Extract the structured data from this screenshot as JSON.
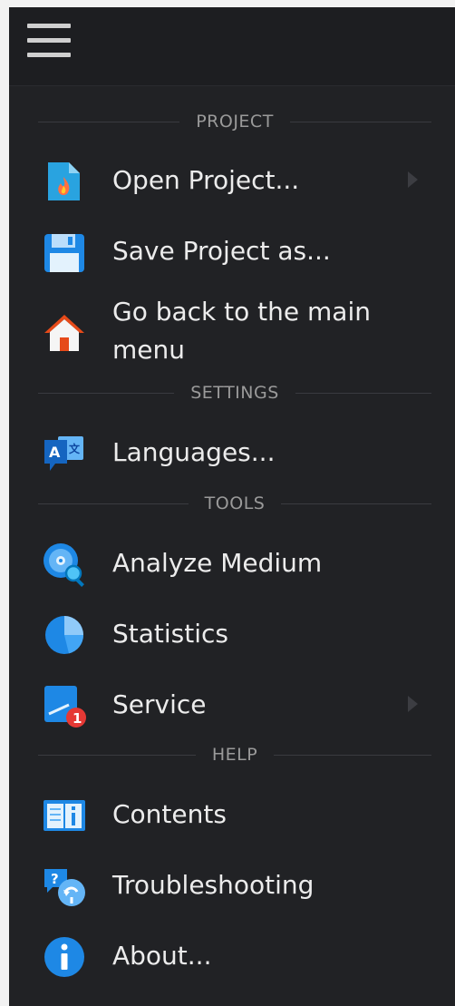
{
  "sections": {
    "project": "PROJECT",
    "settings": "SETTINGS",
    "tools": "TOOLS",
    "help": "HELP"
  },
  "items": {
    "open_project": {
      "label": "Open Project...",
      "icon": "open-file-icon"
    },
    "save_project": {
      "label": "Save Project as...",
      "icon": "floppy-disk-icon"
    },
    "main_menu": {
      "label": "Go back to the main menu",
      "icon": "home-icon"
    },
    "languages": {
      "label": "Languages...",
      "icon": "translate-icon"
    },
    "analyze": {
      "label": "Analyze Medium",
      "icon": "disc-magnifier-icon"
    },
    "statistics": {
      "label": "Statistics",
      "icon": "pie-chart-icon"
    },
    "service": {
      "label": "Service",
      "icon": "service-notification-icon",
      "badge": "1"
    },
    "contents": {
      "label": "Contents",
      "icon": "book-info-icon"
    },
    "troubleshooting": {
      "label": "Troubleshooting",
      "icon": "question-bubbles-icon"
    },
    "about": {
      "label": "About...",
      "icon": "info-icon"
    }
  },
  "colors": {
    "background": "#212225",
    "accent_blue": "#1e88e5",
    "badge_red": "#e53935"
  }
}
